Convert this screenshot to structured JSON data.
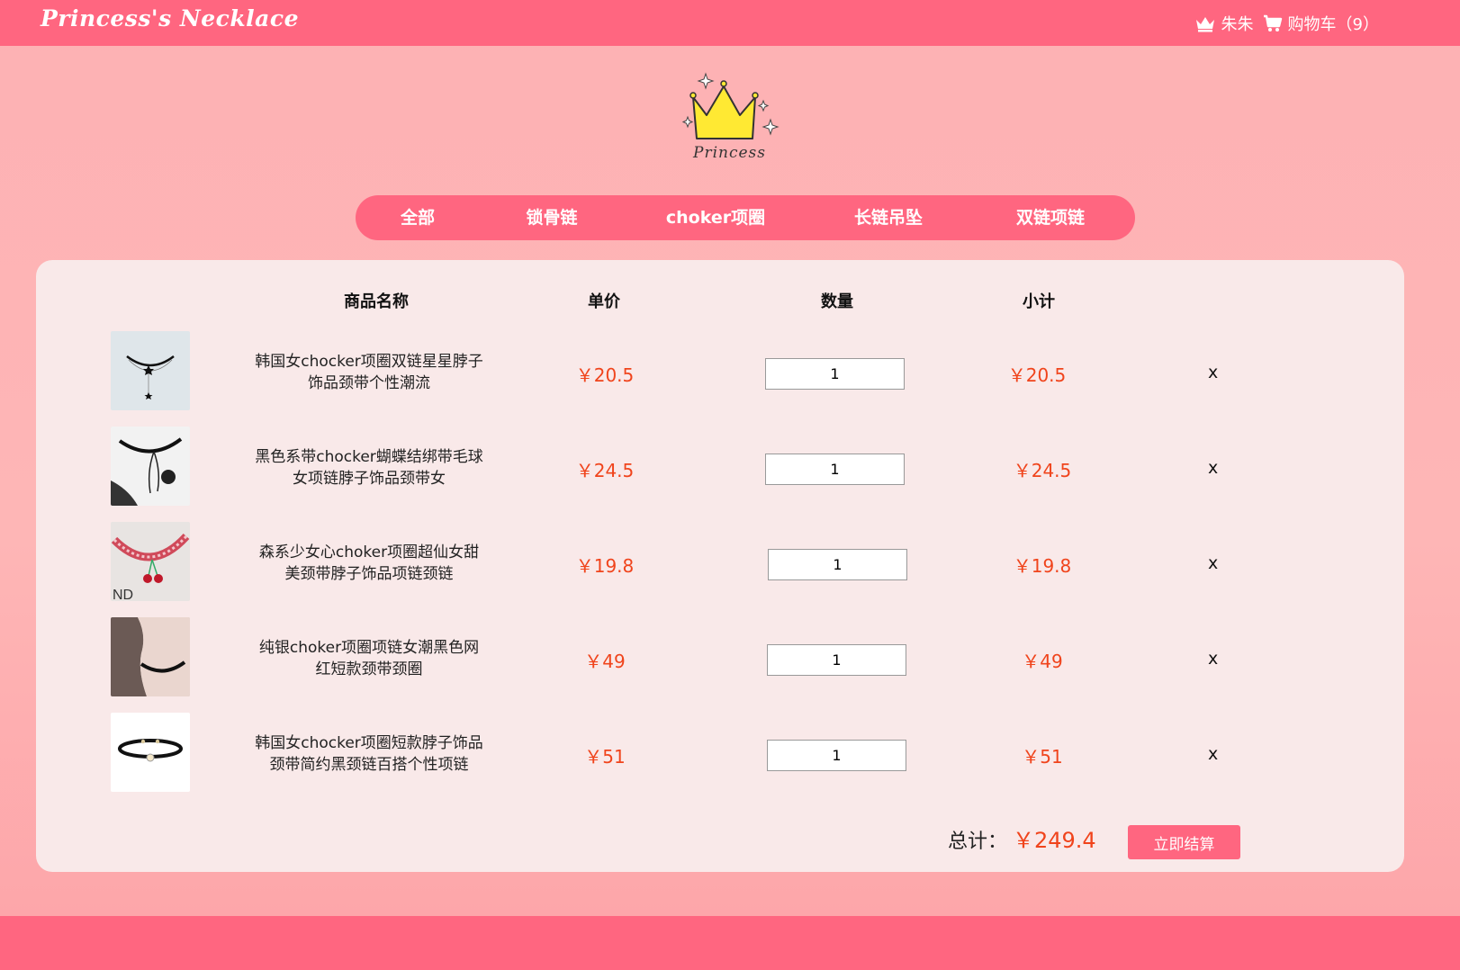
{
  "header": {
    "brand": "Princess's Necklace",
    "user_name": "朱朱",
    "cart_label": "购物车（9）"
  },
  "logo": {
    "text": "Princess",
    "icon": "crown-icon"
  },
  "nav": {
    "tabs": [
      {
        "label": "全部"
      },
      {
        "label": "锁骨链"
      },
      {
        "label": "choker项圈"
      },
      {
        "label": "长链吊坠"
      },
      {
        "label": "双链项链"
      }
    ]
  },
  "cart": {
    "columns": {
      "name": "商品名称",
      "price": "单价",
      "quantity": "数量",
      "subtotal": "小计"
    },
    "items": [
      {
        "name": "韩国女chocker项圈双链星星脖子饰品颈带个性潮流",
        "price": "￥20.5",
        "quantity": "1",
        "subtotal": "￥20.5",
        "remove": "x"
      },
      {
        "name": "黑色系带chocker蝴蝶结绑带毛球女项链脖子饰品颈带女",
        "price": "￥24.5",
        "quantity": "1",
        "subtotal": "￥24.5",
        "remove": "x"
      },
      {
        "name": "森系少女心choker项圈超仙女甜美颈带脖子饰品项链颈链",
        "price": "￥19.8",
        "quantity": "1",
        "subtotal": "￥19.8",
        "remove": "x"
      },
      {
        "name": "纯银choker项圈项链女潮黑色网红短款颈带颈圈",
        "price": "￥49",
        "quantity": "1",
        "subtotal": "￥49",
        "remove": "x"
      },
      {
        "name": "韩国女chocker项圈短款脖子饰品颈带简约黑颈链百搭个性项链",
        "price": "￥51",
        "quantity": "1",
        "subtotal": "￥51",
        "remove": "x"
      }
    ],
    "total_label": "总计：",
    "total_value": "￥249.4",
    "checkout_label": "立即结算"
  },
  "colors": {
    "brand_pink": "#ff6680",
    "background": "#feb2b4",
    "panel": "#f9e9e9",
    "price_red": "#f0441c"
  }
}
